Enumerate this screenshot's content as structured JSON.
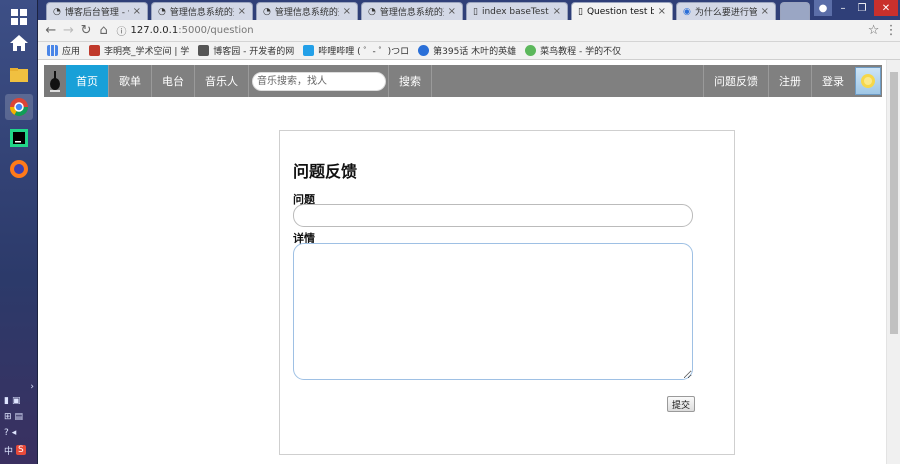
{
  "browser": {
    "tabs": [
      {
        "title": "博客后台管理 - 位",
        "active": false
      },
      {
        "title": "管理信息系统的开",
        "active": false
      },
      {
        "title": "管理信息系统的开",
        "active": false
      },
      {
        "title": "管理信息系统的开",
        "active": false
      },
      {
        "title": "index baseTest",
        "active": false
      },
      {
        "title": "Question test ba",
        "active": true
      },
      {
        "title": "为什么要进行管理",
        "active": false
      }
    ],
    "url_host": "127.0.0.1",
    "url_path": ":5000/question",
    "bookmarks": [
      {
        "label": "应用",
        "color": "#4a86e8"
      },
      {
        "label": "李明亮_学术空间 | 学",
        "color": "#c0392b"
      },
      {
        "label": "博客园 - 开发者的网",
        "color": "#555555"
      },
      {
        "label": "哔哩哔哩 ( ゜- ゜)つロ",
        "color": "#23a0e8"
      },
      {
        "label": "第395话 木叶的英雄",
        "color": "#2a6fd8"
      },
      {
        "label": "菜鸟教程 - 学的不仅",
        "color": "#5cb85c"
      }
    ]
  },
  "navbar": {
    "items": [
      {
        "label": "首页",
        "active": true
      },
      {
        "label": "歌单",
        "active": false
      },
      {
        "label": "电台",
        "active": false
      },
      {
        "label": "音乐人",
        "active": false
      }
    ],
    "search_placeholder": "音乐搜索，找人",
    "search_button": "搜索",
    "right": [
      "问题反馈",
      "注册",
      "登录"
    ]
  },
  "form": {
    "title": "问题反馈",
    "question_label": "问题",
    "detail_label": "详情",
    "submit_label": "提交"
  }
}
